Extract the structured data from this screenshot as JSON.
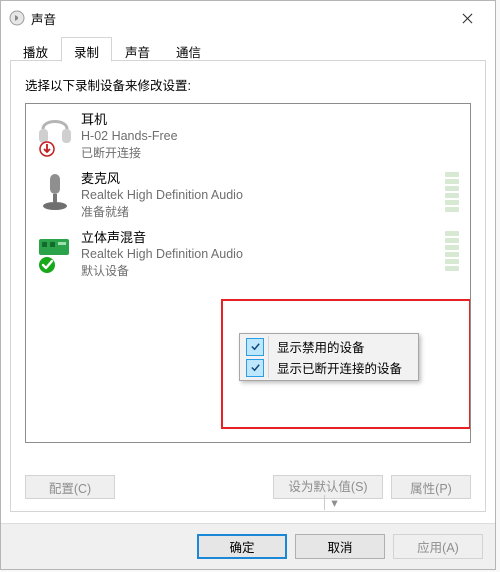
{
  "window": {
    "title": "声音"
  },
  "tabs": [
    {
      "id": "play",
      "label": "播放"
    },
    {
      "id": "record",
      "label": "录制"
    },
    {
      "id": "sound",
      "label": "声音"
    },
    {
      "id": "comm",
      "label": "通信"
    }
  ],
  "active_tab": "录制",
  "panel": {
    "description": "选择以下录制设备来修改设置:",
    "devices": [
      {
        "title": "耳机",
        "subtitle": "H-02 Hands-Free",
        "status": "已断开连接"
      },
      {
        "title": "麦克风",
        "subtitle": "Realtek High Definition Audio",
        "status": "准备就绪"
      },
      {
        "title": "立体声混音",
        "subtitle": "Realtek High Definition Audio",
        "status": "默认设备"
      }
    ]
  },
  "context_menu": {
    "items": [
      {
        "label": "显示禁用的设备",
        "checked": true
      },
      {
        "label": "显示已断开连接的设备",
        "checked": true
      }
    ]
  },
  "panel_buttons": {
    "configure": "配置(C)",
    "set_default": "设为默认值(S)",
    "dropdown_glyph": "▾",
    "properties": "属性(P)"
  },
  "footer_buttons": {
    "ok": "确定",
    "cancel": "取消",
    "apply": "应用(A)"
  }
}
